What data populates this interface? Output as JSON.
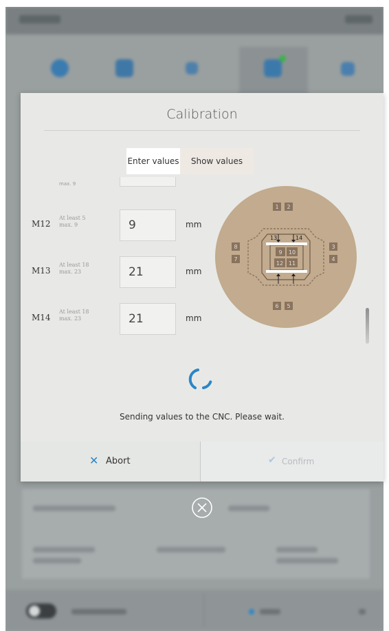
{
  "modal": {
    "title": "Calibration",
    "tabs": [
      {
        "label": "Enter values",
        "active": true
      },
      {
        "label": "Show values",
        "active": false
      }
    ],
    "fields": [
      {
        "name": "M12",
        "hint_line1": "At least 5",
        "hint_line2": "max. 9",
        "value": "9",
        "unit": "mm"
      },
      {
        "name": "M13",
        "hint_line1": "At least 18",
        "hint_line2": "max. 23",
        "value": "21",
        "unit": "mm"
      },
      {
        "name": "M14",
        "hint_line1": "At least 18",
        "hint_line2": "max. 23",
        "value": "21",
        "unit": "mm"
      }
    ],
    "cut_field_hint": "max. 9",
    "status_text": "Sending values to the CNC. Please wait.",
    "abort_label": "Abort",
    "confirm_label": "Confirm",
    "diagram": {
      "markers": [
        "1",
        "2",
        "3",
        "4",
        "5",
        "6",
        "7",
        "8",
        "9",
        "10",
        "11",
        "12",
        "13",
        "14"
      ]
    },
    "accent_color": "#2b86c7"
  }
}
